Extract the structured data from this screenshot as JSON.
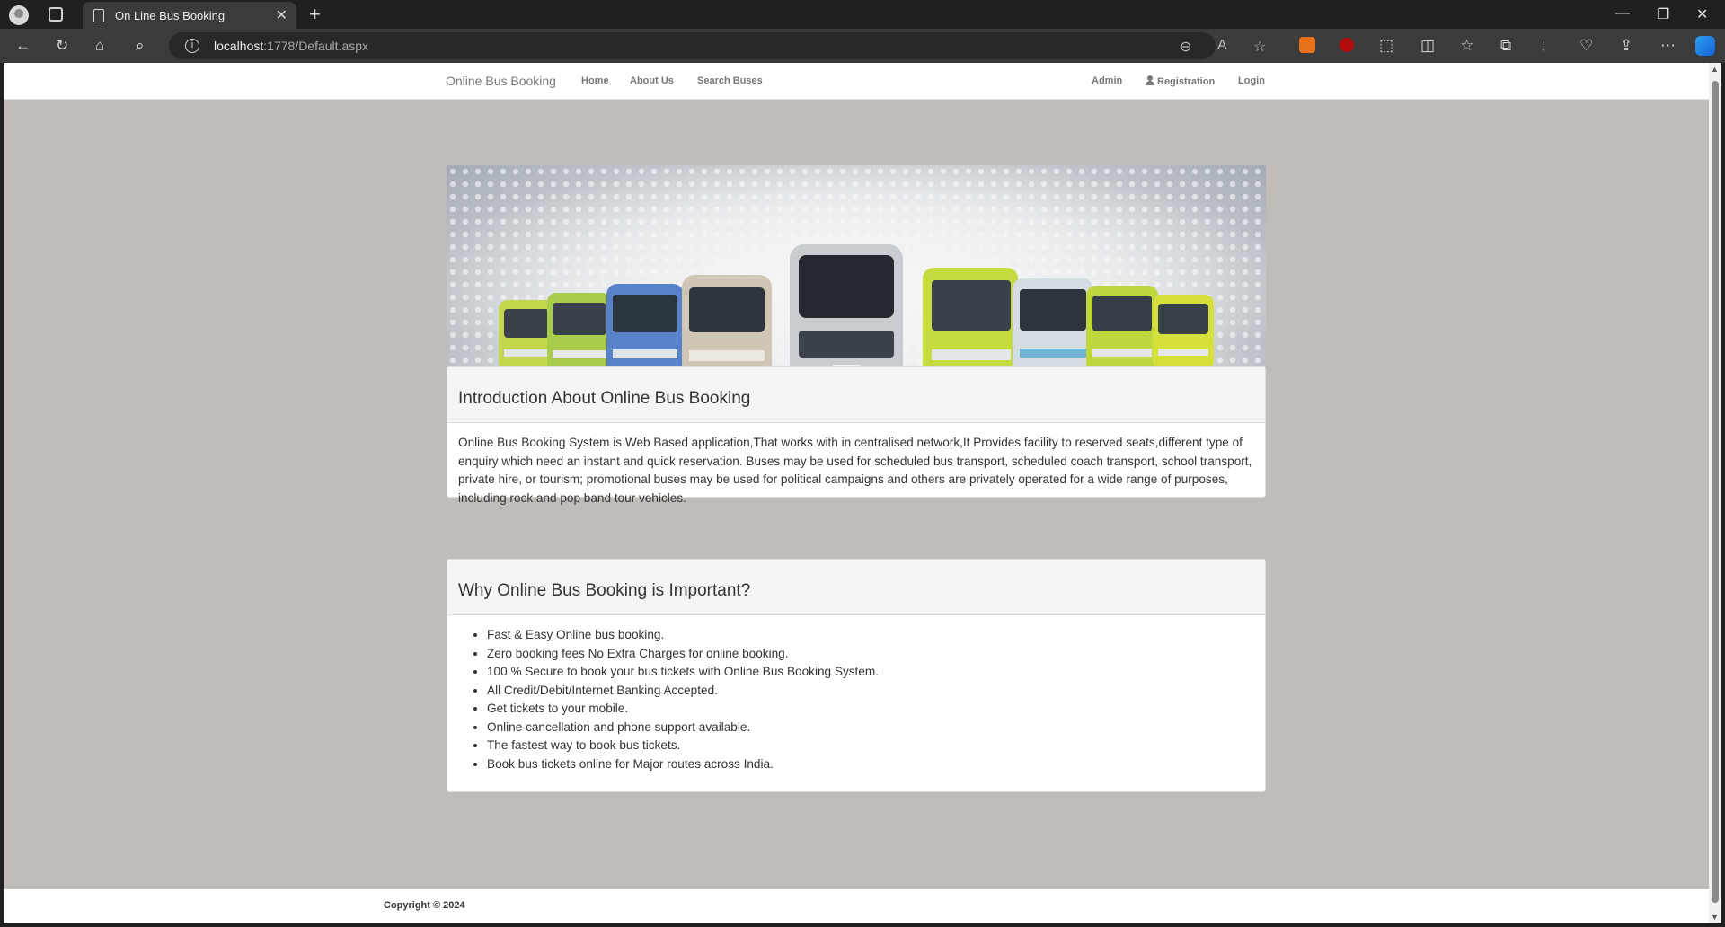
{
  "browser": {
    "tab_title": "On Line Bus Booking",
    "url_host": "localhost",
    "url_rest": ":1778/Default.aspx"
  },
  "nav": {
    "brand": "Online Bus Booking",
    "left_links": [
      "Home",
      "About Us",
      "Search Buses"
    ],
    "admin": "Admin",
    "registration": "Registration",
    "login": "Login"
  },
  "hero": {
    "image_description": "bus-fleet-banner"
  },
  "intro": {
    "heading": "Introduction About Online Bus Booking",
    "text": "Online Bus Booking System is Web Based application,That works with in centralised network,It Provides facility to reserved seats,different type of enquiry which need an instant and quick reservation. Buses may be used for scheduled bus transport, scheduled coach transport, school transport, private hire, or tourism; promotional buses may be used for political campaigns and others are privately operated for a wide range of purposes, including rock and pop band tour vehicles."
  },
  "why": {
    "heading": "Why Online Bus Booking is Important?",
    "items": [
      "Fast & Easy Online bus booking.",
      "Zero booking fees No Extra Charges for online booking.",
      "100 % Secure to book your bus tickets with Online Bus Booking System.",
      "All Credit/Debit/Internet Banking Accepted.",
      "Get tickets to your mobile.",
      "Online cancellation and phone support available.",
      "The fastest way to book bus tickets.",
      "Book bus tickets online for Major routes across India."
    ]
  },
  "footer": {
    "copyright": "Copyright © 2024"
  },
  "colors": {
    "page_bg": "#c1bcb9",
    "panel_head_bg": "#f5f5f5",
    "nav_text": "#777777"
  }
}
